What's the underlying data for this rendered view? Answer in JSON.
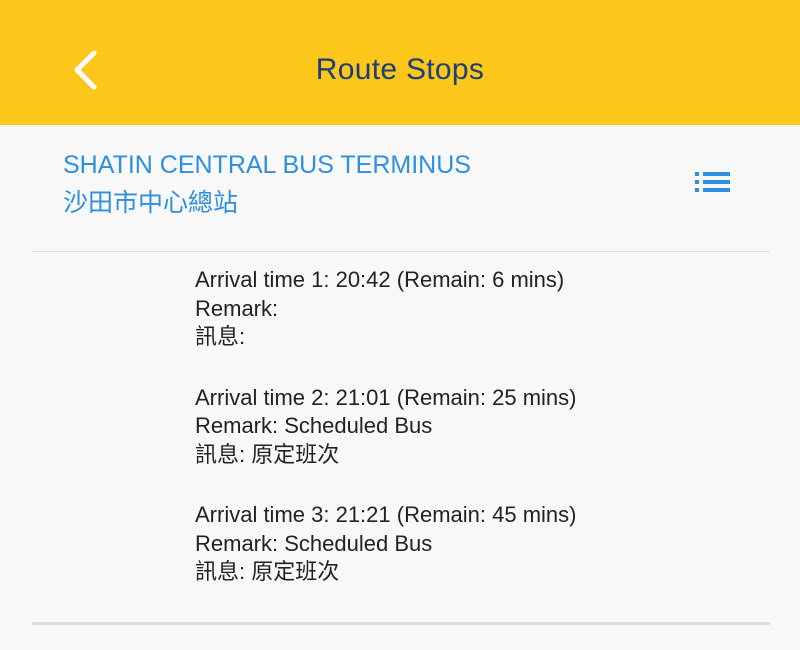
{
  "header": {
    "title": "Route Stops",
    "back_icon": "chevron-left-icon",
    "background_color": "#fcc71a",
    "title_color": "#1d3e78"
  },
  "stop": {
    "name_en": "SHATIN CENTRAL BUS TERMINUS",
    "name_zh": "沙田市中心總站",
    "list_icon": "list-icon",
    "accent_color": "#2d8fe0"
  },
  "arrivals": [
    {
      "time_line": "Arrival time 1: 20:42 (Remain: 6 mins)",
      "remark_line": "Remark:",
      "info_line": "訊息:"
    },
    {
      "time_line": "Arrival time 2: 21:01 (Remain: 25 mins)",
      "remark_line": "Remark: Scheduled Bus",
      "info_line": "訊息: 原定班次"
    },
    {
      "time_line": "Arrival time 3: 21:21 (Remain: 45 mins)",
      "remark_line": "Remark: Scheduled Bus",
      "info_line": "訊息: 原定班次"
    }
  ]
}
